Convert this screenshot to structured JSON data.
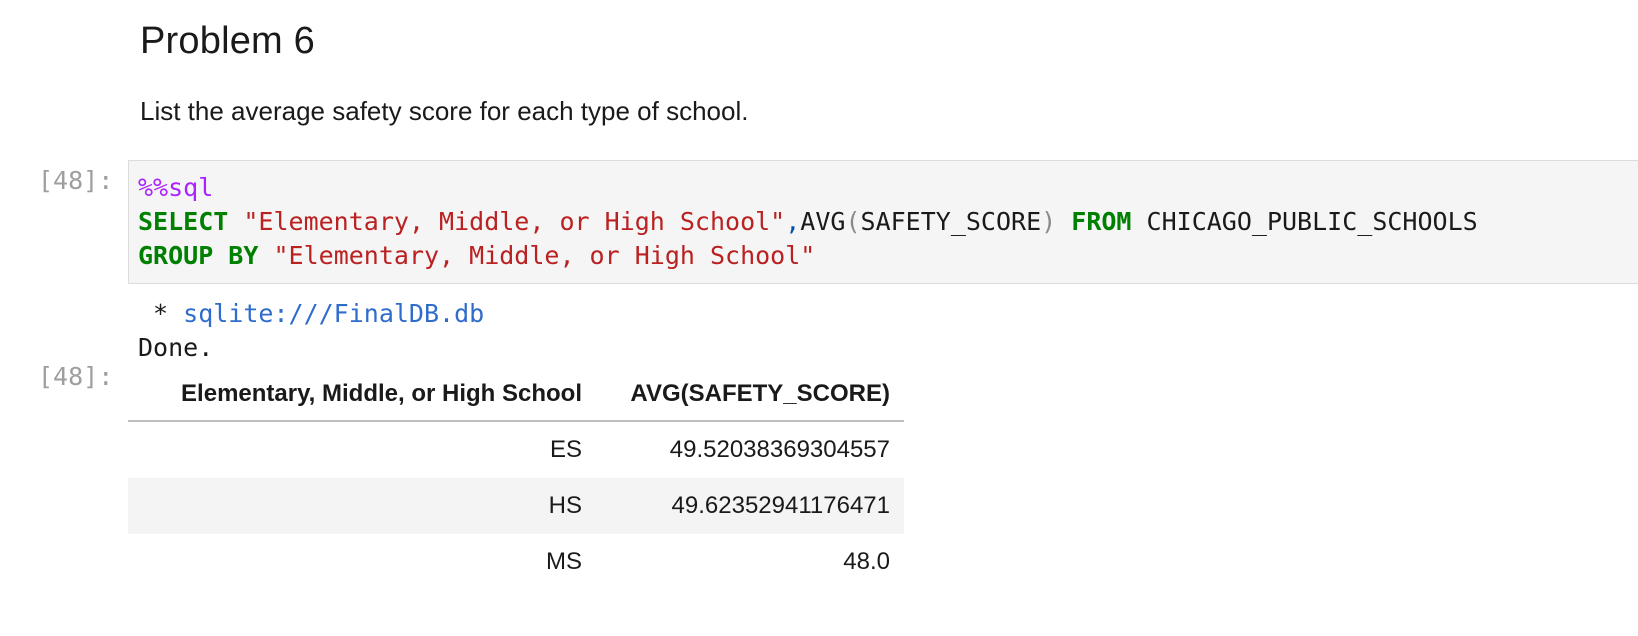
{
  "markdown": {
    "heading": "Problem 6",
    "text": "List the average safety score for each type of school."
  },
  "code_cell": {
    "prompt": "[48]:",
    "magic": "%%sql",
    "line2": {
      "kw1": "SELECT",
      "str1": "\"Elementary, Middle, or High School\"",
      "comma": ",",
      "func": "AVG",
      "open_paren": "(",
      "arg": "SAFETY_SCORE",
      "close_paren": ")",
      "kw2": "FROM",
      "table": "CHICAGO_PUBLIC_SCHOOLS"
    },
    "line3": {
      "kw": "GROUP BY",
      "str": "\"Elementary, Middle, or High School\""
    }
  },
  "output": {
    "stream_prefix": " * ",
    "connection": "sqlite:///FinalDB.db",
    "done": "Done.",
    "prompt": "[48]:",
    "table": {
      "headers": [
        "Elementary, Middle, or High School",
        "AVG(SAFETY_SCORE)"
      ],
      "rows": [
        [
          "ES",
          "49.52038369304557"
        ],
        [
          "HS",
          "49.62352941176471"
        ],
        [
          "MS",
          "48.0"
        ]
      ]
    }
  }
}
